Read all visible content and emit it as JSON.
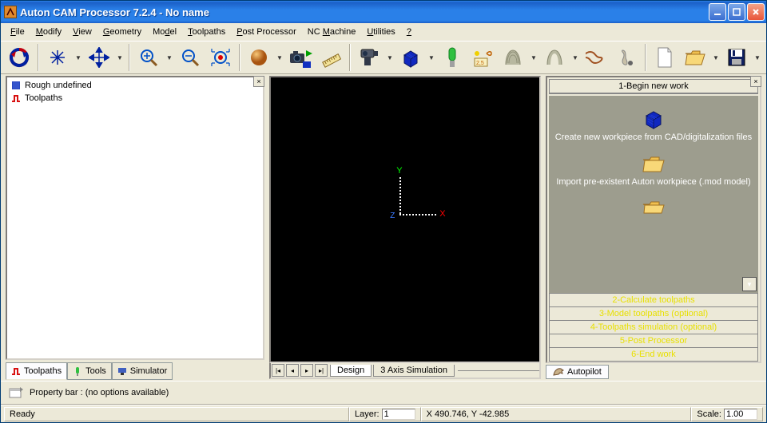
{
  "title": "Auton CAM Processor 7.2.4 - No name",
  "menu": {
    "file": "File",
    "modify": "Modify",
    "view": "View",
    "geometry": "Geometry",
    "model": "Model",
    "toolpaths": "Toolpaths",
    "post": "Post Processor",
    "nc": "NC Machine",
    "utilities": "Utilities",
    "help": "?"
  },
  "tree": {
    "rough": "Rough undefined",
    "toolpaths": "Toolpaths"
  },
  "left_tabs": {
    "toolpaths": "Toolpaths",
    "tools": "Tools",
    "simulator": "Simulator"
  },
  "viewport": {
    "x": "X",
    "y": "Y",
    "z": "Z",
    "tabs": {
      "design": "Design",
      "sim": "3 Axis Simulation"
    }
  },
  "wizard": {
    "header": "1-Begin new work",
    "item1": "Create new workpiece from CAD/digitalization files",
    "item2": "Import pre-existent Auton workpiece (.mod model)",
    "steps": {
      "s2": "2-Calculate toolpaths",
      "s3": "3-Model toolpaths (optional)",
      "s4": "4-Toolpaths simulation (optional)",
      "s5": "5-Post Processor",
      "s6": "6-End work"
    },
    "tab": "Autopilot"
  },
  "propbar": "Property bar : (no options available)",
  "status": {
    "ready": "Ready",
    "layer_label": "Layer:",
    "layer_value": "1",
    "coords": "X 490.746, Y -42.985",
    "scale_label": "Scale:",
    "scale_value": "1.00"
  }
}
